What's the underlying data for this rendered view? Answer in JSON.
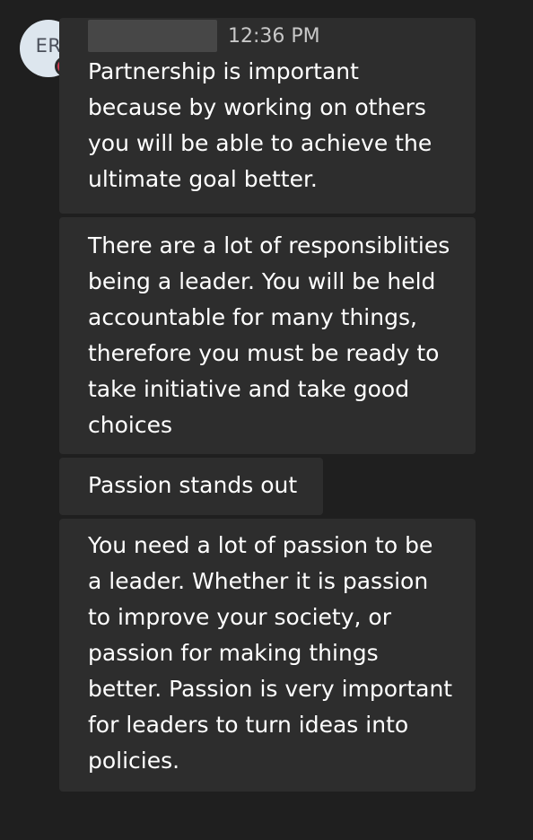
{
  "avatar": {
    "initials": "ER"
  },
  "messages": [
    {
      "timestamp": "12:36 PM",
      "text": "Partnership is important\nbecause by working on others\nyou will be able to achieve the\nultimate goal better."
    },
    {
      "text": "There are a lot of responsiblities\nbeing a leader. You will be held\naccountable for many things,\ntherefore you must be ready to\ntake initiative and take good\nchoices"
    },
    {
      "text": "Passion stands out"
    },
    {
      "text": "You need a lot of passion to be\na leader. Whether it is passion\nto improve your society, or\npassion for making things\nbetter. Passion is very important\nfor leaders to turn ideas into\npolicies."
    }
  ],
  "colors": {
    "background": "#1f1f1f",
    "bubble": "#2d2d2d",
    "status_busy": "#d13a52"
  }
}
